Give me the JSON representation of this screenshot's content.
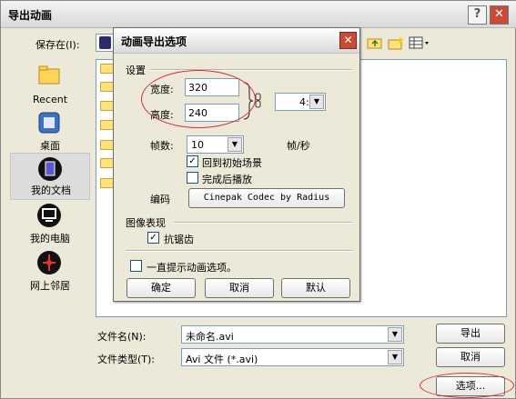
{
  "window": {
    "title": "导出动画"
  },
  "save_in": {
    "label": "保存在(I):"
  },
  "places": [
    {
      "label": "Recent",
      "icon": "recent-icon"
    },
    {
      "label": "桌面",
      "icon": "desktop-icon"
    },
    {
      "label": "我的文档",
      "icon": "my-documents-icon"
    },
    {
      "label": "我的电脑",
      "icon": "my-computer-icon"
    },
    {
      "label": "网上邻居",
      "icon": "network-places-icon"
    }
  ],
  "filename": {
    "label": "文件名(N):",
    "value": "未命名.avi"
  },
  "filetype": {
    "label": "文件类型(T):",
    "value": "Avi 文件 (*.avi)"
  },
  "buttons": {
    "export": "导出",
    "cancel": "取消",
    "options": "选项..."
  },
  "dialog": {
    "title": "动画导出选项",
    "settings_label": "设置",
    "width_label": "宽度:",
    "width_value": "320",
    "height_label": "高度:",
    "height_value": "240",
    "ratio_value": "4:",
    "fps_label": "帧数:",
    "fps_value": "10",
    "fps_unit": "帧/秒",
    "rewind_label": "回到初始场景",
    "rewind_checked": true,
    "loop_label": "完成后播放",
    "loop_checked": false,
    "codec_label": "编码",
    "codec_button": "Cinepak Codec by Radius",
    "image_label": "图像表现",
    "antialias_label": "抗锯齿",
    "antialias_checked": true,
    "always_label": "一直提示动画选项。",
    "always_checked": false,
    "ok": "确定",
    "cancel": "取消",
    "default": "默认"
  },
  "colors": {
    "annotation": "#d0313b",
    "close_red": "#c94a35",
    "folder": "#ffe27a"
  }
}
